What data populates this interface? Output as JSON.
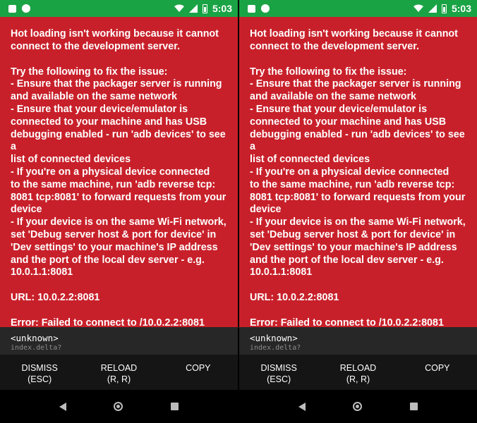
{
  "statusbar": {
    "time": "5:03"
  },
  "redbox": {
    "title": "Hot loading isn't working because it cannot\nconnect to the development server.",
    "body": "Try the following to fix the issue:\n- Ensure that the packager server is running\nand available on the same network\n- Ensure that your device/emulator is\nconnected to your machine and has USB\ndebugging enabled - run 'adb devices' to see a\nlist of connected devices\n- If you're on a physical device connected\nto the same machine, run 'adb reverse tcp:\n8081 tcp:8081' to forward requests from your\ndevice\n- If your device is on the same Wi-Fi network,\nset 'Debug server host & port for device' in\n'Dev settings' to your machine's IP address\nand the port of the local dev server - e.g.\n10.0.1.1:8081",
    "url": "URL: 10.0.2.2:8081",
    "error": "Error: Failed to connect to /10.0.2.2:8081"
  },
  "stack": {
    "method": "<unknown>",
    "file": "index.delta?"
  },
  "buttons": {
    "dismiss": "DISMISS\n(ESC)",
    "reload": "RELOAD\n(R, R)",
    "copy": "COPY"
  }
}
